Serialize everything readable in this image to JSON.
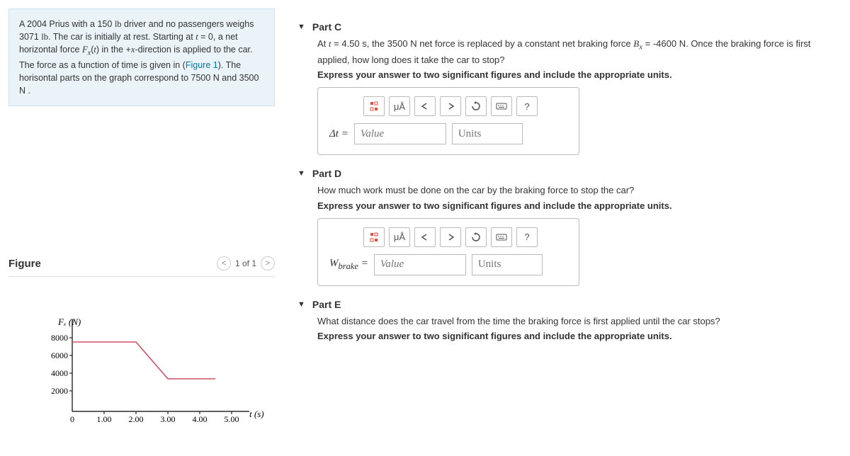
{
  "problem": {
    "text_html": "A 2004 Prius with a 150 <span class='lb'>lb</span> driver and no passengers weighs 3071 <span class='lb'>lb</span>. The car is initially at rest. Starting at <span class='var'>t</span> = 0, a net horizontal force <span class='var'>F<sub>x</sub></span>(<span class='var'>t</span>) in the +<span class='var'>x</span>-direction is applied to the car. The force as a function of time is given in (<span class='figlink'>Figure 1</span>). The horisontal parts on the graph correspond to 7500 N and 3500 N ."
  },
  "figure": {
    "title": "Figure",
    "page": "1 of 1",
    "y_label": "Fₓ (N)",
    "x_label": "t (s)",
    "y_ticks": [
      "2000",
      "4000",
      "6000",
      "8000"
    ],
    "x_ticks": [
      "0",
      "1.00",
      "2.00",
      "3.00",
      "4.00",
      "5.00"
    ]
  },
  "chart_data": {
    "type": "line",
    "title": "",
    "xlabel": "t (s)",
    "ylabel": "Fx (N)",
    "xlim": [
      0,
      5.0
    ],
    "ylim": [
      0,
      8000
    ],
    "x": [
      0,
      2.0,
      3.0,
      4.5
    ],
    "y": [
      7500,
      7500,
      3500,
      3500
    ]
  },
  "partC": {
    "title": "Part C",
    "question_html": "At <span class='var'>t</span> = 4.50 s, the 3500 N net force is replaced by a constant net braking force <span class='var'>B<sub>x</sub></span> = -4600 N. Once the braking force is first applied, how long does it take the car to stop?",
    "instruction": "Express your answer to two significant figures and include the appropriate units.",
    "label": "Δt =",
    "value_placeholder": "Value",
    "units_placeholder": "Units"
  },
  "partD": {
    "title": "Part D",
    "question": "How much work must be done on the car by the braking force to stop the car?",
    "instruction": "Express your answer to two significant figures and include the appropriate units.",
    "label_html": "<span style='font-style:italic'>W</span><sub>brake</sub> =",
    "value_placeholder": "Value",
    "units_placeholder": "Units"
  },
  "partE": {
    "title": "Part E",
    "question": "What distance does the car travel from the time the braking force is first applied until the car stops?",
    "instruction": "Express your answer to two significant figures and include the appropriate units."
  },
  "toolbar": {
    "frac": "▮▯",
    "mu": "μÅ",
    "help": "?"
  }
}
